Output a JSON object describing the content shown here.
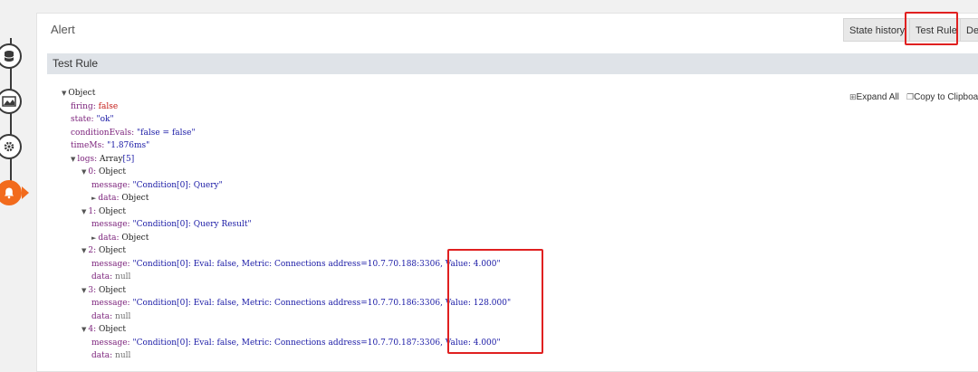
{
  "header": {
    "title": "Alert",
    "buttons": [
      "State history",
      "Test Rule",
      "Dele"
    ]
  },
  "panel": {
    "title": "Test Rule",
    "expand_all": "Expand All",
    "copy": "Copy to Clipboa"
  },
  "tree": {
    "root": "Object",
    "firing_key": "firing:",
    "firing_val": "false",
    "state_key": "state:",
    "state_val": "\"ok\"",
    "cond_key": "conditionEvals:",
    "cond_val": "\"false = false\"",
    "time_key": "timeMs:",
    "time_val": "\"1.876ms\"",
    "logs_key": "logs:",
    "logs_val": "Array",
    "logs_count": "[5]",
    "items": [
      {
        "idx": "0:",
        "type": "Object",
        "message": "\"Condition[0]: Query\"",
        "data_key": "data:",
        "data_val": "Object",
        "data_collapsed": true
      },
      {
        "idx": "1:",
        "type": "Object",
        "message": "\"Condition[0]: Query Result\"",
        "data_key": "data:",
        "data_val": "Object",
        "data_collapsed": true
      },
      {
        "idx": "2:",
        "type": "Object",
        "message": "\"Condition[0]: Eval: false, Metric: Connections address=10.7.70.188:3306, Value: 4.000\"",
        "data_key": "data:",
        "data_val": "null",
        "data_collapsed": false
      },
      {
        "idx": "3:",
        "type": "Object",
        "message": "\"Condition[0]: Eval: false, Metric: Connections address=10.7.70.186:3306, Value: 128.000\"",
        "data_key": "data:",
        "data_val": "null",
        "data_collapsed": false
      },
      {
        "idx": "4:",
        "type": "Object",
        "message": "\"Condition[0]: Eval: false, Metric: Connections address=10.7.70.187:3306, Value: 4.000\"",
        "data_key": "data:",
        "data_val": "null",
        "data_collapsed": false
      }
    ],
    "message_key": "message:"
  },
  "icons": [
    "database-icon",
    "dashboard-icon",
    "gear-icon",
    "bell-icon"
  ],
  "colors": {
    "accent": "#f26b1d",
    "highlight": "#e02020"
  }
}
